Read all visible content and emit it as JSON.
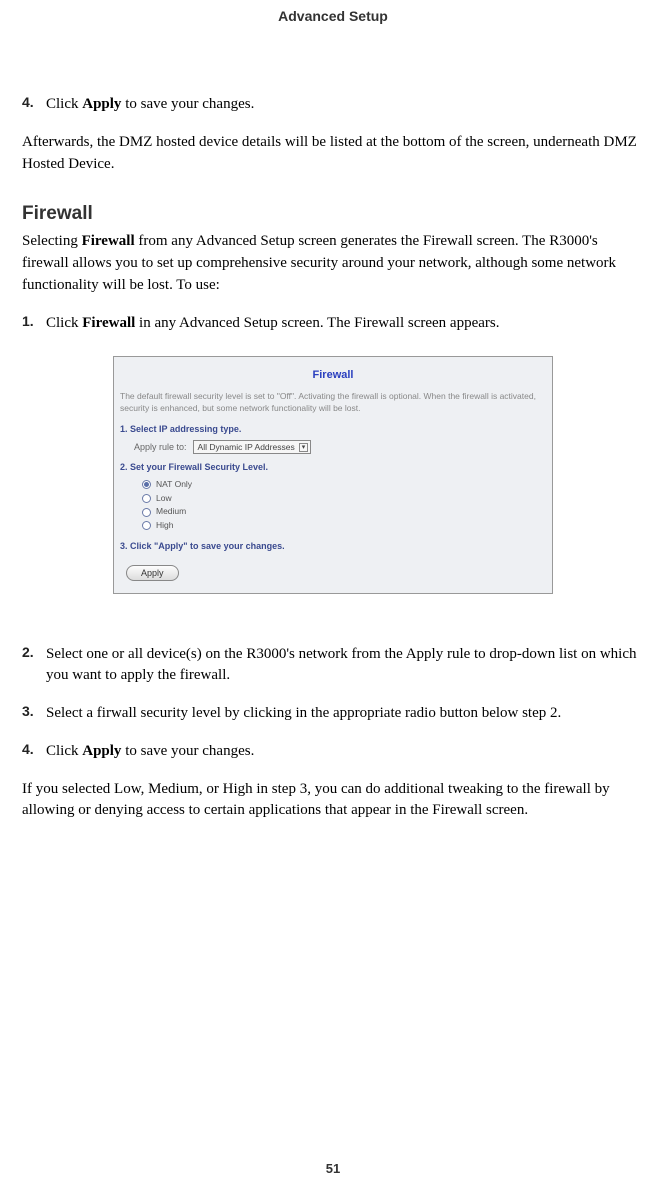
{
  "header": {
    "title": "Advanced Setup"
  },
  "top_step": {
    "num": "4.",
    "pre": "Click ",
    "bold": "Apply",
    "post": " to save your changes."
  },
  "after_para": "Afterwards, the DMZ hosted device details will be listed at the bottom of the screen, underneath DMZ Hosted Device.",
  "section": {
    "heading": "Firewall"
  },
  "intro": {
    "pre": "Selecting ",
    "bold": "Firewall",
    "post": " from any Advanced Setup screen generates the Firewall screen. The R3000's firewall allows you to set up comprehensive security around your net­work, although some network functionality will be lost. To use:"
  },
  "step1": {
    "num": "1.",
    "pre": "Click ",
    "bold": "Firewall",
    "post": " in any Advanced Setup screen. The Firewall screen appears."
  },
  "panel": {
    "title": "Firewall",
    "desc": "The default firewall security level is set to \"Off\". Activating the firewall is optional. When the firewall is activated, security is enhanced, but some network functionality will be lost.",
    "s1": "1. Select IP addressing type.",
    "apply_label": "Apply rule to:",
    "select_value": "All Dynamic IP Addresses",
    "s2": "2. Set your Firewall Security Level.",
    "radios": [
      "NAT Only",
      "Low",
      "Medium",
      "High"
    ],
    "selected_radio": 0,
    "s3": "3. Click \"Apply\" to save your changes.",
    "apply_btn": "Apply"
  },
  "step2": {
    "num": "2.",
    "text": "Select one or all device(s) on the R3000's network from the Apply rule to drop-down list on which you want to apply the firewall."
  },
  "step3": {
    "num": "3.",
    "text": "Select a firwall security level by clicking in the appropriate radio button below step 2."
  },
  "step4": {
    "num": "4.",
    "pre": "Click ",
    "bold": "Apply",
    "post": " to save your changes."
  },
  "tail": "If you selected Low, Medium, or High in step 3, you can do additional tweaking to the firewall by allowing or denying access to certain applications that appear in the Firewall screen.",
  "page": "51"
}
